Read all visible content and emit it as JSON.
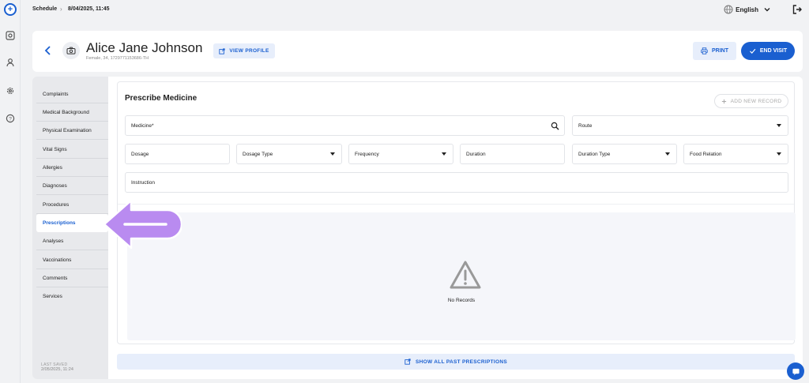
{
  "topbar": {
    "breadcrumb_1": "Schedule",
    "breadcrumb_sep": "›",
    "breadcrumb_2": "8/04/2025, 11:45",
    "language": "English"
  },
  "patient": {
    "name": "Alice Jane Johnson",
    "meta": "Female, 34, 1729771153686-TH"
  },
  "header": {
    "view_profile": "VIEW PROFILE",
    "print": "PRINT",
    "end_visit": "END VISIT"
  },
  "sidebar": {
    "items": [
      {
        "label": "Complaints"
      },
      {
        "label": "Medical Background"
      },
      {
        "label": "Physical Examination"
      },
      {
        "label": "Vital Signs"
      },
      {
        "label": "Allergies"
      },
      {
        "label": "Diagnoses"
      },
      {
        "label": "Procedures"
      },
      {
        "label": "Prescriptions"
      },
      {
        "label": "Analyses"
      },
      {
        "label": "Vaccinations"
      },
      {
        "label": "Comments"
      },
      {
        "label": "Services"
      }
    ],
    "active": "Prescriptions",
    "last_saved_label": "LAST SAVED",
    "last_saved_value": "2/05/2025, 11:24"
  },
  "prescribe": {
    "title": "Prescribe Medicine",
    "add_new": "ADD NEW RECORD",
    "fields": {
      "medicine": "Medicine*",
      "route": "Route",
      "dosage": "Dosage",
      "dosage_type": "Dosage Type",
      "frequency": "Frequency",
      "duration": "Duration",
      "duration_type": "Duration Type",
      "food_relation": "Food Relation",
      "instruction": "Instruction"
    },
    "empty_text": "No Records",
    "show_past": "SHOW ALL PAST PRESCRIPTIONS"
  },
  "colors": {
    "accent": "#1a5fd0",
    "accent_light": "#e7eefb",
    "highlight_arrow": "#b98bf0"
  },
  "icons": [
    "logo-icon",
    "dashboard-icon",
    "user-icon",
    "settings-icon",
    "help-icon",
    "globe-icon",
    "chevron-down-icon",
    "logout-icon",
    "back-icon",
    "camera-icon",
    "external-link-icon",
    "print-icon",
    "check-icon",
    "plus-icon",
    "search-icon",
    "warning-icon",
    "chat-icon"
  ]
}
